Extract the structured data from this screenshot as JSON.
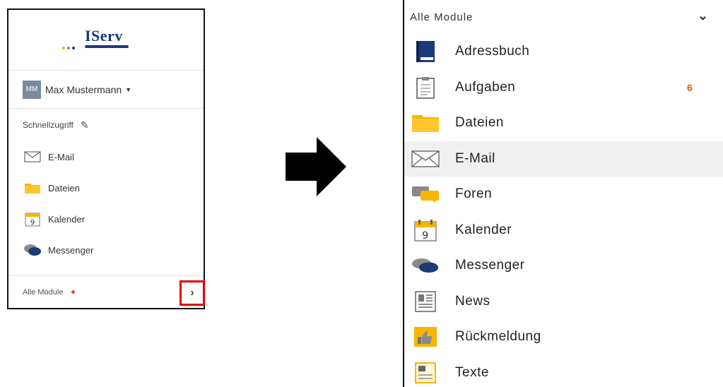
{
  "left_panel": {
    "logo": {
      "text": "IServ",
      "dot_colors": [
        "#f2b600",
        "#7b8aa0",
        "#1b3a78"
      ]
    },
    "user": {
      "initials": "MM",
      "name": "Max Mustermann"
    },
    "quick_access": {
      "label": "Schnellzugriff"
    },
    "items": [
      {
        "label": "E-Mail",
        "icon": "envelope-icon"
      },
      {
        "label": "Dateien",
        "icon": "folder-icon"
      },
      {
        "label": "Kalender",
        "icon": "calendar-icon",
        "calendar_day": "9"
      },
      {
        "label": "Messenger",
        "icon": "chat-bubbles-icon"
      }
    ],
    "all_modules": {
      "label": "Alle Module"
    }
  },
  "right_panel": {
    "header": {
      "label": "Alle Module"
    },
    "items": [
      {
        "label": "Adressbuch",
        "icon": "address-book-icon"
      },
      {
        "label": "Aufgaben",
        "icon": "clipboard-icon",
        "badge": "6"
      },
      {
        "label": "Dateien",
        "icon": "folder-icon"
      },
      {
        "label": "E-Mail",
        "icon": "envelope-icon",
        "active": true
      },
      {
        "label": "Foren",
        "icon": "forum-icon"
      },
      {
        "label": "Kalender",
        "icon": "calendar-icon",
        "calendar_day": "9"
      },
      {
        "label": "Messenger",
        "icon": "chat-bubbles-icon"
      },
      {
        "label": "News",
        "icon": "newspaper-icon"
      },
      {
        "label": "Rückmeldung",
        "icon": "feedback-icon"
      },
      {
        "label": "Texte",
        "icon": "text-document-icon"
      }
    ]
  },
  "colors": {
    "brand_blue": "#1b3a78",
    "folder_yellow": "#f7b500",
    "badge_orange": "#d9541e",
    "highlight_red": "#e30000"
  }
}
